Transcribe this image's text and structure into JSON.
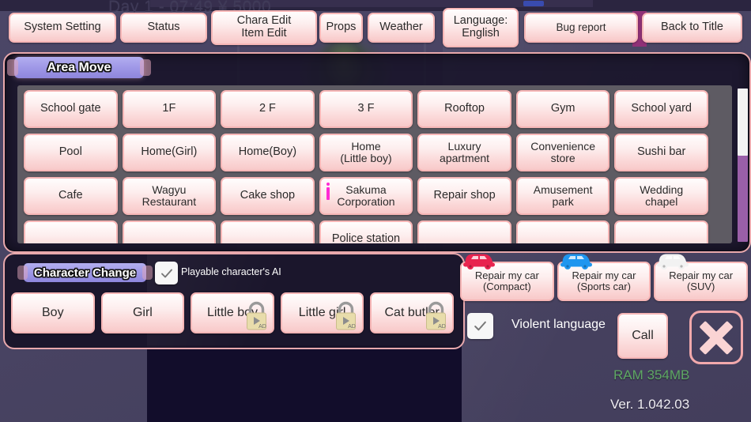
{
  "hud": {
    "status_line": "Day 1 - 07:49 ¥ 5000"
  },
  "topbar": {
    "buttons": [
      {
        "id": "system-setting",
        "label": "System Setting"
      },
      {
        "id": "status",
        "label": "Status"
      },
      {
        "id": "chara-edit-item-edit",
        "label": "Chara Edit\nItem Edit"
      },
      {
        "id": "props",
        "label": "Props"
      },
      {
        "id": "weather",
        "label": "Weather"
      },
      {
        "id": "language",
        "label": "Language:\nEnglish"
      },
      {
        "id": "bug-report",
        "label": "Bug report"
      },
      {
        "id": "back-to-title",
        "label": "Back to Title"
      }
    ]
  },
  "area_move": {
    "title": "Area Move",
    "locations": [
      {
        "label": "School gate"
      },
      {
        "label": "1F"
      },
      {
        "label": "2 F"
      },
      {
        "label": "3 F"
      },
      {
        "label": "Rooftop"
      },
      {
        "label": "Gym"
      },
      {
        "label": "School yard"
      },
      {
        "label": "Pool"
      },
      {
        "label": "Home(Girl)"
      },
      {
        "label": "Home(Boy)"
      },
      {
        "label": "Home\n(Little boy)"
      },
      {
        "label": "Luxury\napartment"
      },
      {
        "label": "Convenience\nstore"
      },
      {
        "label": "Sushi bar"
      },
      {
        "label": "Cafe"
      },
      {
        "label": "Wagyu\nRestaurant"
      },
      {
        "label": "Cake shop"
      },
      {
        "label": "Sakuma\nCorporation",
        "info": true
      },
      {
        "label": "Repair shop"
      },
      {
        "label": "Amusement\npark"
      },
      {
        "label": "Wedding\nchapel"
      },
      {
        "label": ""
      },
      {
        "label": ""
      },
      {
        "label": ""
      },
      {
        "label": "Police station"
      },
      {
        "label": ""
      },
      {
        "label": ""
      },
      {
        "label": ""
      }
    ],
    "scrollbar": {
      "thumb_position_percent": 0,
      "thumb_size_percent": 44
    }
  },
  "character_change": {
    "title": "Character Change",
    "ai_checkbox": {
      "label": "Playable character's AI",
      "checked": true
    },
    "characters": [
      {
        "label": "Boy",
        "locked": false
      },
      {
        "label": "Girl",
        "locked": false
      },
      {
        "label": "Little boy",
        "locked": true,
        "badge": "AD"
      },
      {
        "label": "Little girl",
        "locked": true,
        "badge": "AD"
      },
      {
        "label": "Cat butler",
        "locked": true,
        "badge": "AD"
      }
    ]
  },
  "car_actions": [
    {
      "label": "Repair my car\n(Compact)",
      "icon": "car-icon",
      "color": "#e8244f"
    },
    {
      "label": "Repair my car\n(Sports car)",
      "icon": "car-icon",
      "color": "#1f96ef"
    },
    {
      "label": "Repair my car\n(SUV)",
      "icon": "car-icon",
      "color": "#f2f2f2"
    }
  ],
  "bottom_controls": {
    "violent_checkbox": {
      "label": "Violent language",
      "checked": true
    },
    "call_label": "Call",
    "close_label": "close"
  },
  "footer": {
    "ram": "RAM 354MB",
    "version": "Ver. 1.042.03"
  },
  "colors": {
    "background": "#494463",
    "button_pink": "#f8c9c9",
    "tab_purple": "#9d96e6",
    "ram_green": "#5fa865",
    "info_magenta": "#ff2ad4",
    "scroll_track": "#9a5fa8"
  }
}
